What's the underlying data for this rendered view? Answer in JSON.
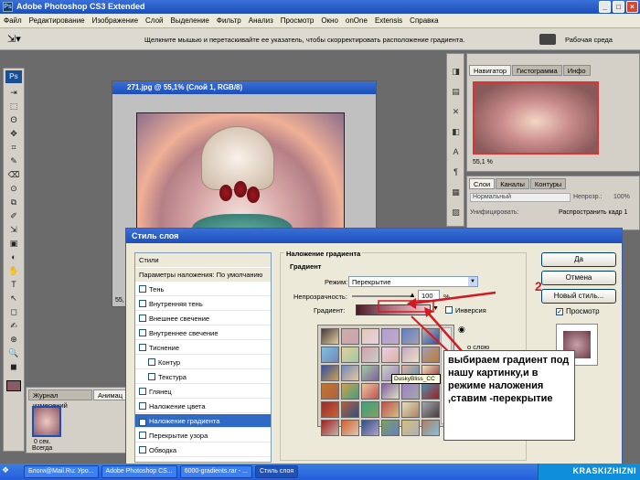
{
  "app": {
    "title": "Adobe Photoshop CS3 Extended",
    "icon_label": "Ps"
  },
  "menu": [
    "Файл",
    "Редактирование",
    "Изображение",
    "Слой",
    "Выделение",
    "Фильтр",
    "Анализ",
    "Просмотр",
    "Окно",
    "onOne",
    "Extensis",
    "Справка"
  ],
  "options": {
    "hint": "Щелкните мышью и перетаскивайте ее указатель, чтобы скорректировать расположение градиента.",
    "workspace": "Рабочая среда"
  },
  "document": {
    "title": "271.jpg @ 55,1% (Слой 1, RGB/8)",
    "zoom_badge": "55,"
  },
  "navigator": {
    "tabs": [
      "Навигатор",
      "Гистограмма",
      "Инфо"
    ],
    "zoom": "55,1 %"
  },
  "layers": {
    "tabs": [
      "Слои",
      "Каналы",
      "Контуры"
    ],
    "blend": "Нормальный",
    "opacity_label": "Непрозр.:",
    "opacity": "100%",
    "lock_label": "Унифицировать:",
    "spread_label": "Распространить кадр 1"
  },
  "history": {
    "tabs": [
      "Журнал измерений",
      "Анимац"
    ],
    "frame_time": "0 сек.",
    "loop": "Всегда"
  },
  "dialog": {
    "title": "Стиль слоя",
    "styles_header": "Стили",
    "blend_defaults": "Параметры наложения: По умолчанию",
    "items": [
      {
        "label": "Тень",
        "checked": false,
        "sub": false
      },
      {
        "label": "Внутренняя тень",
        "checked": false,
        "sub": false
      },
      {
        "label": "Внешнее свечение",
        "checked": false,
        "sub": false
      },
      {
        "label": "Внутреннее свечение",
        "checked": false,
        "sub": false
      },
      {
        "label": "Тиснение",
        "checked": false,
        "sub": false
      },
      {
        "label": "Контур",
        "checked": false,
        "sub": true
      },
      {
        "label": "Текстура",
        "checked": false,
        "sub": true
      },
      {
        "label": "Глянец",
        "checked": false,
        "sub": false
      },
      {
        "label": "Наложение цвета",
        "checked": false,
        "sub": false
      },
      {
        "label": "Наложение градиента",
        "checked": true,
        "sub": false,
        "selected": true
      },
      {
        "label": "Перекрытие узора",
        "checked": false,
        "sub": false
      },
      {
        "label": "Обводка",
        "checked": false,
        "sub": false
      }
    ],
    "section_title": "Наложение градиента",
    "group_title": "Градиент",
    "mode_label": "Режим:",
    "mode_value": "Перекрытие",
    "opacity_label": "Непрозрачность:",
    "opacity_value": "100",
    "opacity_unit": "%",
    "gradient_label": "Градиент:",
    "invert_label": "Инверсия",
    "tooltip": "DuskyBliss_CC",
    "side_text": "о слою",
    "buttons": {
      "ok": "Да",
      "cancel": "Отмена",
      "new_style": "Новый стиль...",
      "preview": "Просмотр"
    },
    "swatches": [
      "#4a3a3a",
      "#c8b0a8",
      "#e0c8b0",
      "#b0a0d0",
      "#6080c0",
      "#b0b0b0",
      "#80c0e0",
      "#e0d0a0",
      "#d0a0b0",
      "#e8d0e8",
      "#c0a8c8",
      "#a0a0b8",
      "#3050a0",
      "#7088b8",
      "#a0c8a0",
      "#c8d0c0",
      "#e0b0a0",
      "#f0e0c0",
      "#c07830",
      "#d0a050",
      "#e8c8a0",
      "#8060a0",
      "#a080c0",
      "#5090b0",
      "#903030",
      "#b06040",
      "#40a080",
      "#c05050",
      "#e0e0c0",
      "#a0a8b0",
      "#a02020",
      "#d06030",
      "#305080",
      "#80a060",
      "#d0c080",
      "#b08060"
    ]
  },
  "callout": {
    "text": "выбираем градиент под нашу картинку,и в режиме наложения ,ставим -перекрытие",
    "color": "#d31a24"
  },
  "annotation": {
    "number": "2"
  },
  "taskbar": [
    "Блоги@Mail.Ru: Уро...",
    "Adobe Photoshop CS...",
    "6000-gradients.rar - ...",
    "Стиль слоя"
  ],
  "watermark": "KRASKIZHIZNI"
}
